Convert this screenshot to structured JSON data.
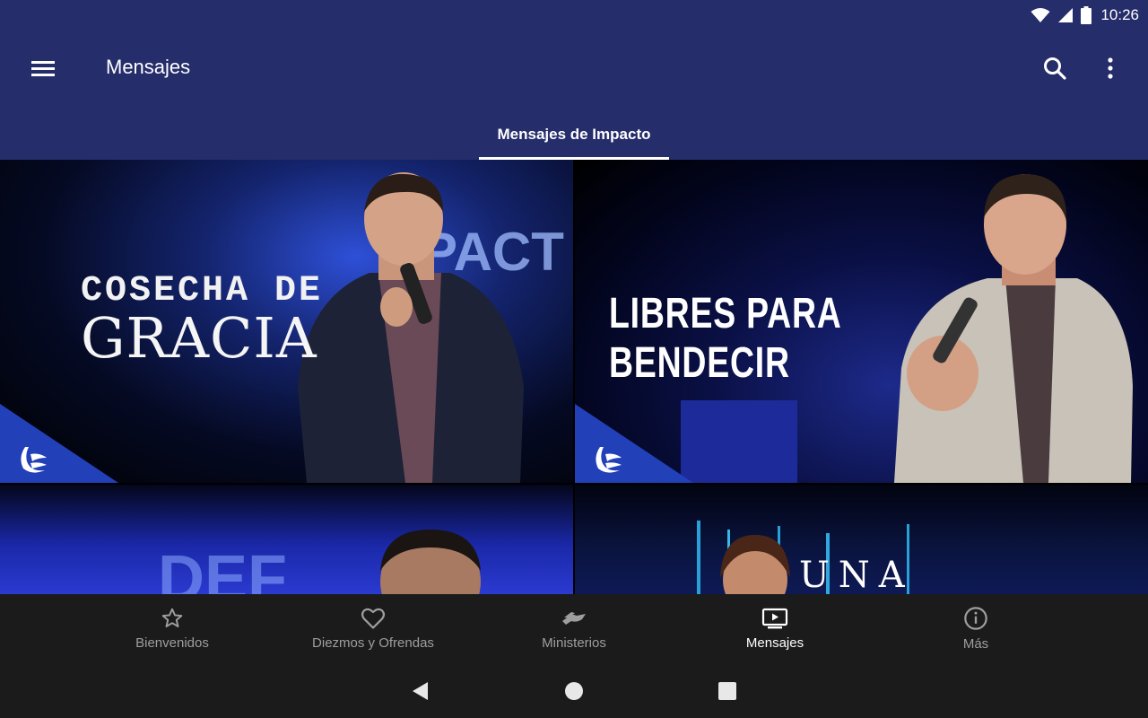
{
  "status_bar": {
    "time": "10:26",
    "icons": [
      "wifi-icon",
      "signal-icon",
      "battery-icon"
    ]
  },
  "app_bar": {
    "title": "Mensajes",
    "menu_icon": "menu-icon",
    "search_icon": "search-icon",
    "more_icon": "more-vert-icon"
  },
  "tabs": [
    {
      "label": "Mensajes de Impacto",
      "selected": true
    }
  ],
  "messages": [
    {
      "title_line1": "COSECHA DE",
      "title_line2": "GRACIA",
      "background_text": "PACT"
    },
    {
      "title": "LIBRES PARA BENDECIR"
    },
    {
      "background_text": "DEF"
    },
    {
      "title": "UNA ORACION"
    }
  ],
  "bottom_nav": {
    "items": [
      {
        "label": "Bienvenidos",
        "icon": "star-icon",
        "active": false
      },
      {
        "label": "Diezmos y Ofrendas",
        "icon": "heart-icon",
        "active": false
      },
      {
        "label": "Ministerios",
        "icon": "handshake-icon",
        "active": false
      },
      {
        "label": "Mensajes",
        "icon": "video-icon",
        "active": true
      },
      {
        "label": "Más",
        "icon": "info-icon",
        "active": false
      }
    ]
  },
  "system_nav": {
    "icons": [
      "back-icon",
      "home-icon",
      "recents-icon"
    ]
  },
  "colors": {
    "primary": "#252d6b",
    "nav_background": "#1b1b1b",
    "corner_accent": "#2240b8"
  }
}
